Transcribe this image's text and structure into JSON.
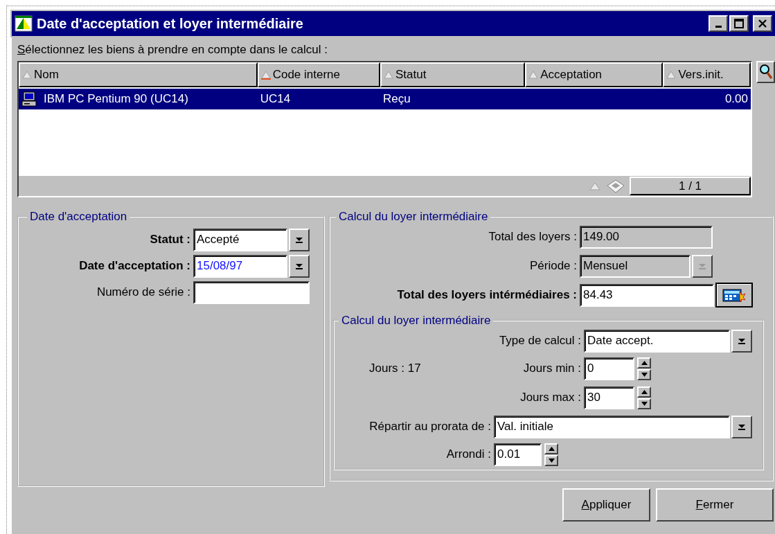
{
  "window": {
    "title": "Date d'acceptation et loyer intermédiaire"
  },
  "list_label": "Sélectionnez les biens à prendre en compte dans le calcul :",
  "table": {
    "columns": [
      {
        "label": "Nom",
        "sorted": false
      },
      {
        "label": "Code interne",
        "sorted": true
      },
      {
        "label": "Statut",
        "sorted": false
      },
      {
        "label": "Acceptation",
        "sorted": false
      },
      {
        "label": "Vers.init.",
        "sorted": false
      }
    ],
    "rows": [
      {
        "selected": true,
        "cells": [
          "IBM PC Pentium 90 (UC14)",
          "UC14",
          "Reçu",
          "",
          "0.00"
        ]
      }
    ],
    "pager": "1 / 1"
  },
  "acceptance_group": {
    "title": "Date d'acceptation",
    "fields": [
      {
        "label": "Statut :",
        "value": "Accepté",
        "kind": "combo",
        "bold": true,
        "modified": false
      },
      {
        "label": "Date d'acceptation :",
        "value": "15/08/97",
        "kind": "combo",
        "bold": true,
        "modified": true
      },
      {
        "label": "Numéro de série :",
        "kind": "text",
        "bold": false
      }
    ]
  },
  "rent_group": {
    "title": "Calcul du loyer intermédiaire",
    "fields": [
      {
        "label": "Total des loyers :",
        "value": "149.00",
        "kind": "text",
        "bold": false,
        "disabled": true
      },
      {
        "label": "Période :",
        "value": "Mensuel",
        "kind": "combo",
        "bold": false,
        "disabled": true
      },
      {
        "label": "Total des loyers intérmédiaires :",
        "value": "84.43",
        "kind": "calc",
        "bold": true,
        "disabled": false
      }
    ],
    "inner_group": {
      "title": "Calcul du loyer intermédiaire",
      "days": "Jours : 17",
      "fields": [
        {
          "label": "Type de calcul :",
          "value": "Date accept.",
          "kind": "combo"
        },
        {
          "label": "Jours min :",
          "value": "0",
          "kind": "spin"
        },
        {
          "label": "Jours max :",
          "value": "30",
          "kind": "spin"
        },
        {
          "label": "Répartir au prorata de :",
          "value": "Val. initiale",
          "kind": "combo"
        },
        {
          "label": "Arrondi :",
          "value": "0.01",
          "kind": "spin"
        }
      ]
    }
  },
  "buttons": [
    "Appliquer",
    "Fermer"
  ]
}
